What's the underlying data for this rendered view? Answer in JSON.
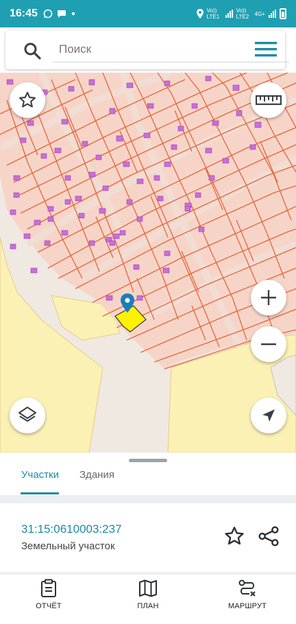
{
  "status_bar": {
    "time": "16:45",
    "left_icons": [
      "whatsapp-icon",
      "message-icon",
      "dot-icon"
    ],
    "sim1": "Vo)) LTE1",
    "sim2": "Vo)) LTE2",
    "net": "4G+"
  },
  "search": {
    "placeholder": "Поиск"
  },
  "map": {
    "colors": {
      "parcel_fill": "#f6d5c8",
      "parcel_stroke": "#e8643c",
      "building": "#c86fd8",
      "yellow_zone": "#fbf1b4",
      "selected": "#fff200",
      "marker": "#1a7dbf"
    }
  },
  "tabs": {
    "active": "Участки",
    "second": "Здания"
  },
  "parcel": {
    "cadastral_number": "31:15:0610003:237",
    "type": "Земельный участок"
  },
  "bottom_nav": {
    "report": "ОТЧЁТ",
    "plan": "ПЛАН",
    "route": "МАРШРУТ"
  }
}
